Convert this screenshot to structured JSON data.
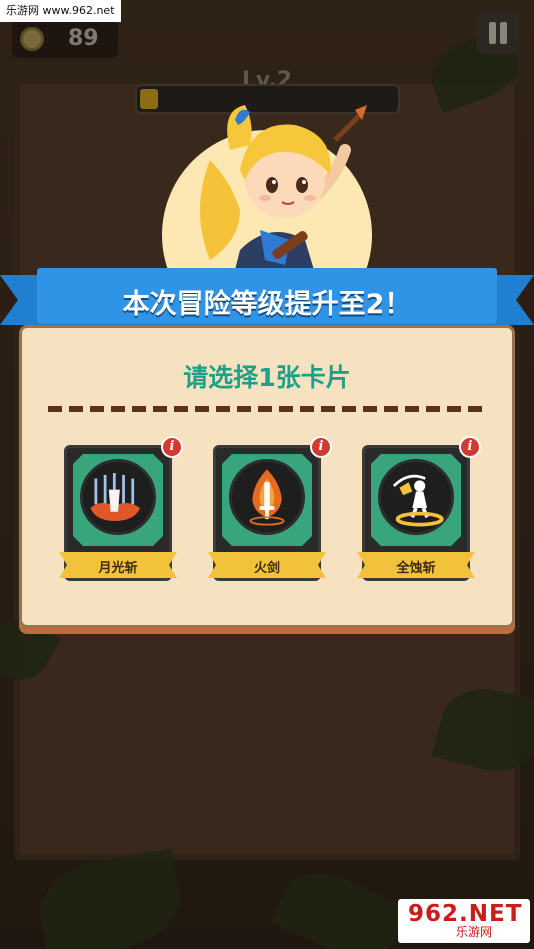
{
  "watermark_top": "乐游网 www.962.net",
  "watermark_bottom": {
    "logo": "962.NET",
    "sub": "乐游网"
  },
  "hud": {
    "coins": "89",
    "level": "Lv.2",
    "xp_progress": 0.07
  },
  "banner": {
    "text": "本次冒险等级提升至2！"
  },
  "panel": {
    "title": "请选择1张卡片"
  },
  "cards": [
    {
      "name": "月光斩",
      "icon": "moonlight-slash-icon",
      "info": "i"
    },
    {
      "name": "火剑",
      "icon": "fire-sword-icon",
      "info": "i"
    },
    {
      "name": "全蚀斩",
      "icon": "eclipse-slash-icon",
      "info": "i"
    }
  ],
  "colors": {
    "ribbon": "#2f93e6",
    "panel": "#f6e2c0",
    "title": "#20a187",
    "card_frame": "#39a57d",
    "label": "#f2c33a"
  }
}
